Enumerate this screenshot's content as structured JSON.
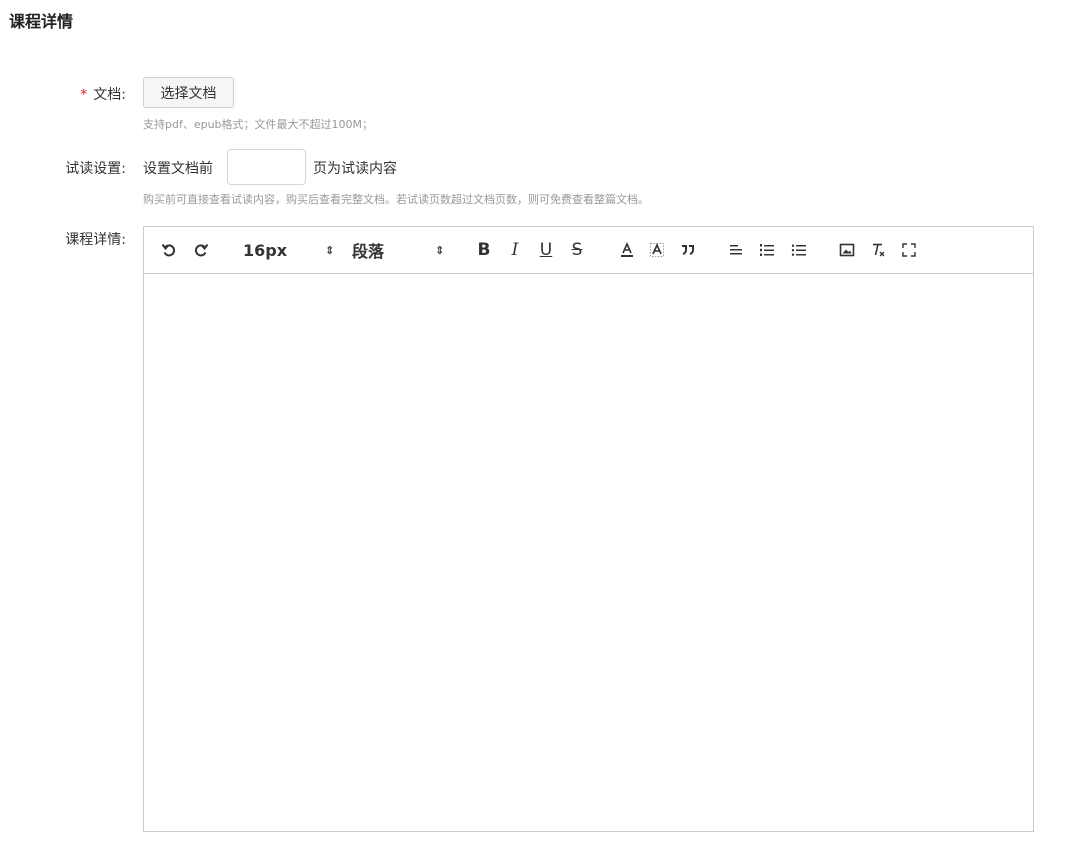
{
  "page": {
    "title": "课程详情"
  },
  "form": {
    "document": {
      "required_mark": "*",
      "label": "文档:",
      "button_label": "选择文档",
      "hint": "支持pdf、epub格式；文件最大不超过100M；"
    },
    "trial": {
      "label": "试读设置:",
      "prefix": "设置文档前",
      "input_value": "",
      "suffix": "页为试读内容",
      "hint": "购买前可直接查看试读内容，购买后查看完整文档。若试读页数超过文档页数，则可免费查看整篇文档。"
    },
    "details": {
      "label": "课程详情:"
    }
  },
  "editor": {
    "font_size": "16px",
    "block_format": "段落",
    "select_arrows": "⇕",
    "bold_glyph": "B",
    "italic_glyph": "I",
    "underline_glyph": "U",
    "strike_glyph": "S",
    "content": "",
    "toolbar_icons": [
      "undo-icon",
      "redo-icon",
      "bold-icon",
      "italic-icon",
      "underline-icon",
      "strikethrough-icon",
      "font-color-icon",
      "background-color-icon",
      "quote-icon",
      "align-left-icon",
      "ordered-list-icon",
      "unordered-list-icon",
      "image-icon",
      "clear-format-icon",
      "fullscreen-icon"
    ]
  },
  "colors": {
    "required": "#e02424",
    "hint": "#999999",
    "border": "#cccccc"
  }
}
